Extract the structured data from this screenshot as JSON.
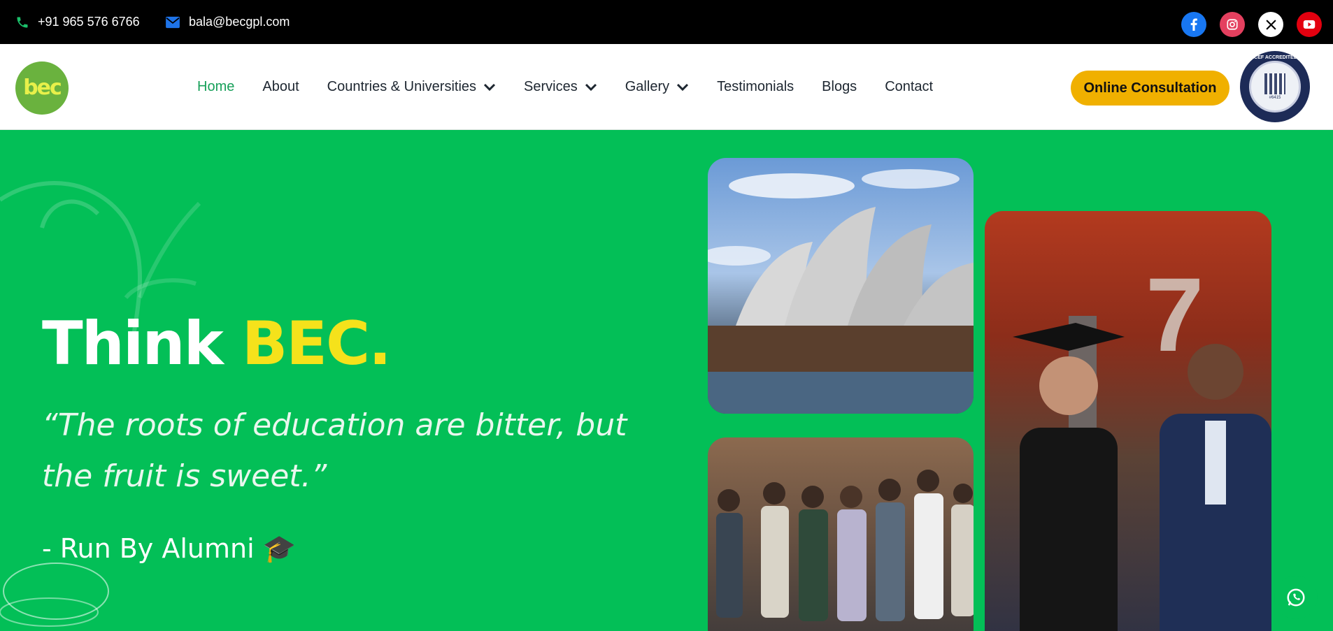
{
  "topbar": {
    "phone": "+91 965 576 6766",
    "email": "bala@becgpl.com",
    "socials": [
      "facebook-icon",
      "instagram-icon",
      "x-icon",
      "youtube-icon"
    ]
  },
  "nav": {
    "logo_text": "bec",
    "items": [
      {
        "label": "Home",
        "active": true
      },
      {
        "label": "About"
      },
      {
        "label": "Countries & Universities",
        "dropdown": true
      },
      {
        "label": "Services",
        "dropdown": true
      },
      {
        "label": "Gallery",
        "dropdown": true
      },
      {
        "label": "Testimonials"
      },
      {
        "label": "Blogs"
      },
      {
        "label": "Contact"
      }
    ],
    "cta": "Online Consultation",
    "badge": {
      "title": "ICEF ACCREDITED",
      "id": "#6415"
    }
  },
  "hero": {
    "headline_prefix": "Think",
    "headline_accent": "BEC.",
    "quote": "“The roots of education are bitter, but the fruit is sweet.”",
    "tagline": "- Run By Alumni 🎓"
  },
  "colors": {
    "hero_bg": "#03bf57",
    "accent_yellow": "#f5e21b",
    "cta_bg": "#f0b000",
    "nav_active": "#18a05a"
  }
}
